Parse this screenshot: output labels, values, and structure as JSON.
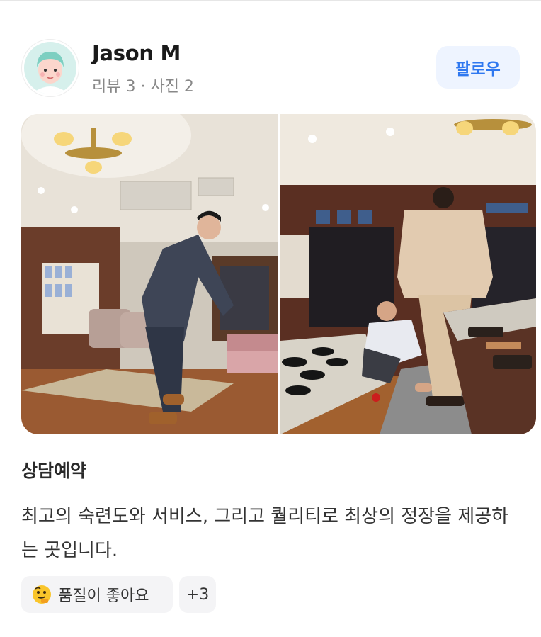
{
  "profile": {
    "name": "Jason M",
    "meta": "리뷰 3 · 사진 2",
    "follow_label": "팔로우"
  },
  "review": {
    "title": "상담예약",
    "body": "최고의 숙련도와 서비스, 그리고 퀄리티로 최상의 정장을 제공하는 곳입니다.",
    "tags": [
      {
        "icon": "thinking-face-icon",
        "label": "품질이 좋아요"
      },
      {
        "label": "+3"
      }
    ]
  },
  "colors": {
    "accent": "#2f78f0",
    "follow_bg": "#eef4ff",
    "tag_bg": "#f4f4f6",
    "meta_text": "#888888"
  }
}
